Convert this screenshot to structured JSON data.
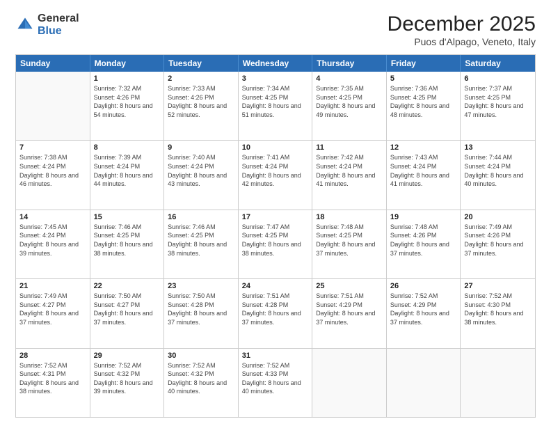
{
  "logo": {
    "general": "General",
    "blue": "Blue"
  },
  "title": "December 2025",
  "location": "Puos d'Alpago, Veneto, Italy",
  "header_days": [
    "Sunday",
    "Monday",
    "Tuesday",
    "Wednesday",
    "Thursday",
    "Friday",
    "Saturday"
  ],
  "rows": [
    [
      {
        "day": "",
        "empty": true
      },
      {
        "day": "1",
        "sunrise": "Sunrise: 7:32 AM",
        "sunset": "Sunset: 4:26 PM",
        "daylight": "Daylight: 8 hours and 54 minutes."
      },
      {
        "day": "2",
        "sunrise": "Sunrise: 7:33 AM",
        "sunset": "Sunset: 4:26 PM",
        "daylight": "Daylight: 8 hours and 52 minutes."
      },
      {
        "day": "3",
        "sunrise": "Sunrise: 7:34 AM",
        "sunset": "Sunset: 4:25 PM",
        "daylight": "Daylight: 8 hours and 51 minutes."
      },
      {
        "day": "4",
        "sunrise": "Sunrise: 7:35 AM",
        "sunset": "Sunset: 4:25 PM",
        "daylight": "Daylight: 8 hours and 49 minutes."
      },
      {
        "day": "5",
        "sunrise": "Sunrise: 7:36 AM",
        "sunset": "Sunset: 4:25 PM",
        "daylight": "Daylight: 8 hours and 48 minutes."
      },
      {
        "day": "6",
        "sunrise": "Sunrise: 7:37 AM",
        "sunset": "Sunset: 4:25 PM",
        "daylight": "Daylight: 8 hours and 47 minutes."
      }
    ],
    [
      {
        "day": "7",
        "sunrise": "Sunrise: 7:38 AM",
        "sunset": "Sunset: 4:24 PM",
        "daylight": "Daylight: 8 hours and 46 minutes."
      },
      {
        "day": "8",
        "sunrise": "Sunrise: 7:39 AM",
        "sunset": "Sunset: 4:24 PM",
        "daylight": "Daylight: 8 hours and 44 minutes."
      },
      {
        "day": "9",
        "sunrise": "Sunrise: 7:40 AM",
        "sunset": "Sunset: 4:24 PM",
        "daylight": "Daylight: 8 hours and 43 minutes."
      },
      {
        "day": "10",
        "sunrise": "Sunrise: 7:41 AM",
        "sunset": "Sunset: 4:24 PM",
        "daylight": "Daylight: 8 hours and 42 minutes."
      },
      {
        "day": "11",
        "sunrise": "Sunrise: 7:42 AM",
        "sunset": "Sunset: 4:24 PM",
        "daylight": "Daylight: 8 hours and 41 minutes."
      },
      {
        "day": "12",
        "sunrise": "Sunrise: 7:43 AM",
        "sunset": "Sunset: 4:24 PM",
        "daylight": "Daylight: 8 hours and 41 minutes."
      },
      {
        "day": "13",
        "sunrise": "Sunrise: 7:44 AM",
        "sunset": "Sunset: 4:24 PM",
        "daylight": "Daylight: 8 hours and 40 minutes."
      }
    ],
    [
      {
        "day": "14",
        "sunrise": "Sunrise: 7:45 AM",
        "sunset": "Sunset: 4:24 PM",
        "daylight": "Daylight: 8 hours and 39 minutes."
      },
      {
        "day": "15",
        "sunrise": "Sunrise: 7:46 AM",
        "sunset": "Sunset: 4:25 PM",
        "daylight": "Daylight: 8 hours and 38 minutes."
      },
      {
        "day": "16",
        "sunrise": "Sunrise: 7:46 AM",
        "sunset": "Sunset: 4:25 PM",
        "daylight": "Daylight: 8 hours and 38 minutes."
      },
      {
        "day": "17",
        "sunrise": "Sunrise: 7:47 AM",
        "sunset": "Sunset: 4:25 PM",
        "daylight": "Daylight: 8 hours and 38 minutes."
      },
      {
        "day": "18",
        "sunrise": "Sunrise: 7:48 AM",
        "sunset": "Sunset: 4:25 PM",
        "daylight": "Daylight: 8 hours and 37 minutes."
      },
      {
        "day": "19",
        "sunrise": "Sunrise: 7:48 AM",
        "sunset": "Sunset: 4:26 PM",
        "daylight": "Daylight: 8 hours and 37 minutes."
      },
      {
        "day": "20",
        "sunrise": "Sunrise: 7:49 AM",
        "sunset": "Sunset: 4:26 PM",
        "daylight": "Daylight: 8 hours and 37 minutes."
      }
    ],
    [
      {
        "day": "21",
        "sunrise": "Sunrise: 7:49 AM",
        "sunset": "Sunset: 4:27 PM",
        "daylight": "Daylight: 8 hours and 37 minutes."
      },
      {
        "day": "22",
        "sunrise": "Sunrise: 7:50 AM",
        "sunset": "Sunset: 4:27 PM",
        "daylight": "Daylight: 8 hours and 37 minutes."
      },
      {
        "day": "23",
        "sunrise": "Sunrise: 7:50 AM",
        "sunset": "Sunset: 4:28 PM",
        "daylight": "Daylight: 8 hours and 37 minutes."
      },
      {
        "day": "24",
        "sunrise": "Sunrise: 7:51 AM",
        "sunset": "Sunset: 4:28 PM",
        "daylight": "Daylight: 8 hours and 37 minutes."
      },
      {
        "day": "25",
        "sunrise": "Sunrise: 7:51 AM",
        "sunset": "Sunset: 4:29 PM",
        "daylight": "Daylight: 8 hours and 37 minutes."
      },
      {
        "day": "26",
        "sunrise": "Sunrise: 7:52 AM",
        "sunset": "Sunset: 4:29 PM",
        "daylight": "Daylight: 8 hours and 37 minutes."
      },
      {
        "day": "27",
        "sunrise": "Sunrise: 7:52 AM",
        "sunset": "Sunset: 4:30 PM",
        "daylight": "Daylight: 8 hours and 38 minutes."
      }
    ],
    [
      {
        "day": "28",
        "sunrise": "Sunrise: 7:52 AM",
        "sunset": "Sunset: 4:31 PM",
        "daylight": "Daylight: 8 hours and 38 minutes."
      },
      {
        "day": "29",
        "sunrise": "Sunrise: 7:52 AM",
        "sunset": "Sunset: 4:32 PM",
        "daylight": "Daylight: 8 hours and 39 minutes."
      },
      {
        "day": "30",
        "sunrise": "Sunrise: 7:52 AM",
        "sunset": "Sunset: 4:32 PM",
        "daylight": "Daylight: 8 hours and 40 minutes."
      },
      {
        "day": "31",
        "sunrise": "Sunrise: 7:52 AM",
        "sunset": "Sunset: 4:33 PM",
        "daylight": "Daylight: 8 hours and 40 minutes."
      },
      {
        "day": "",
        "empty": true
      },
      {
        "day": "",
        "empty": true
      },
      {
        "day": "",
        "empty": true
      }
    ]
  ]
}
